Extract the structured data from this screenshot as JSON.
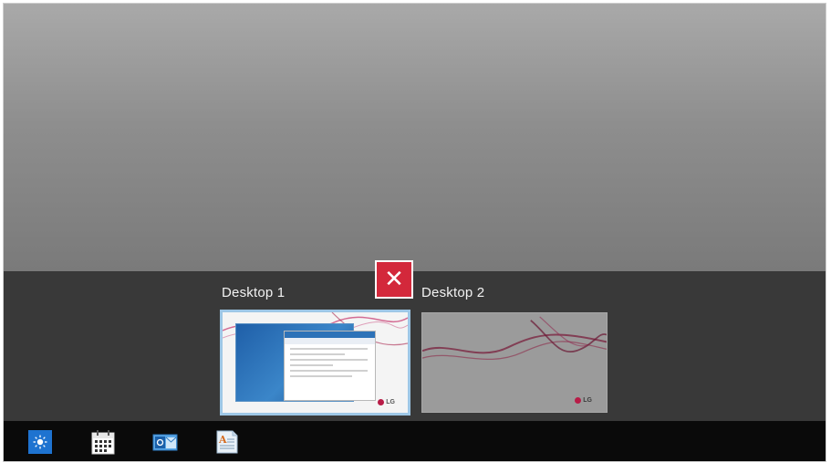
{
  "task_view": {
    "desktops": [
      {
        "label": "Desktop 1",
        "active": true,
        "lg_logo_text": "LG"
      },
      {
        "label": "Desktop 2",
        "active": false,
        "lg_logo_text": "LG"
      }
    ],
    "close_glyph": "✕"
  },
  "taskbar": {
    "apps": [
      {
        "icon": "weather-sun-icon"
      },
      {
        "icon": "calendar-icon"
      },
      {
        "icon": "outlook-mail-icon"
      },
      {
        "icon": "document-reader-icon"
      }
    ]
  },
  "colors": {
    "close_button": "#d3283b",
    "selected_border": "#9ec7e6",
    "taskbar": "#0a0a0a",
    "task_view_strip": "#393939",
    "wallpaper_accent": "#b81c47"
  }
}
